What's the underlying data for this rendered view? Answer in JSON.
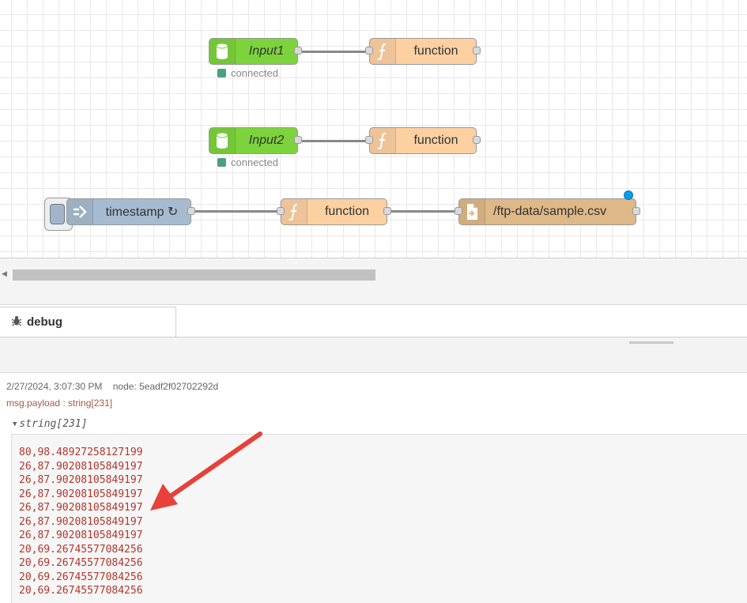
{
  "flow": {
    "nodes": [
      {
        "id": "input1",
        "label": "Input1",
        "type": "db",
        "color": "#7cd33c",
        "status": "connected"
      },
      {
        "id": "function1",
        "label": "function",
        "type": "function",
        "color": "#fdd0a2"
      },
      {
        "id": "input2",
        "label": "Input2",
        "type": "db",
        "color": "#7cd33c",
        "status": "connected"
      },
      {
        "id": "function2",
        "label": "function",
        "type": "function",
        "color": "#fdd0a2"
      },
      {
        "id": "timestamp",
        "label": "timestamp ↻",
        "type": "inject",
        "color": "#a6bbcf"
      },
      {
        "id": "function3",
        "label": "function",
        "type": "function",
        "color": "#fdd0a2"
      },
      {
        "id": "filewrite",
        "label": "/ftp-data/sample.csv",
        "type": "file",
        "color": "#deb887"
      }
    ],
    "status_color": "#4c9f81"
  },
  "sidebar": {
    "tab_label": "debug"
  },
  "debug": {
    "meta": "2/27/2024, 3:07:30 PM    node: 5eadf2f02702292d",
    "topic": "msg.payload : string[231]",
    "toggle": "string[231]",
    "lines": [
      "80,98.48927258127199",
      "26,87.90208105849197",
      "26,87.90208105849197",
      "26,87.90208105849197",
      "26,87.90208105849197",
      "26,87.90208105849197",
      "26,87.90208105849197",
      "20,69.26745577084256",
      "20,69.26745577084256",
      "20,69.26745577084256",
      "20,69.26745577084256"
    ]
  },
  "annotation": {
    "arrow_color": "#e8403a"
  }
}
